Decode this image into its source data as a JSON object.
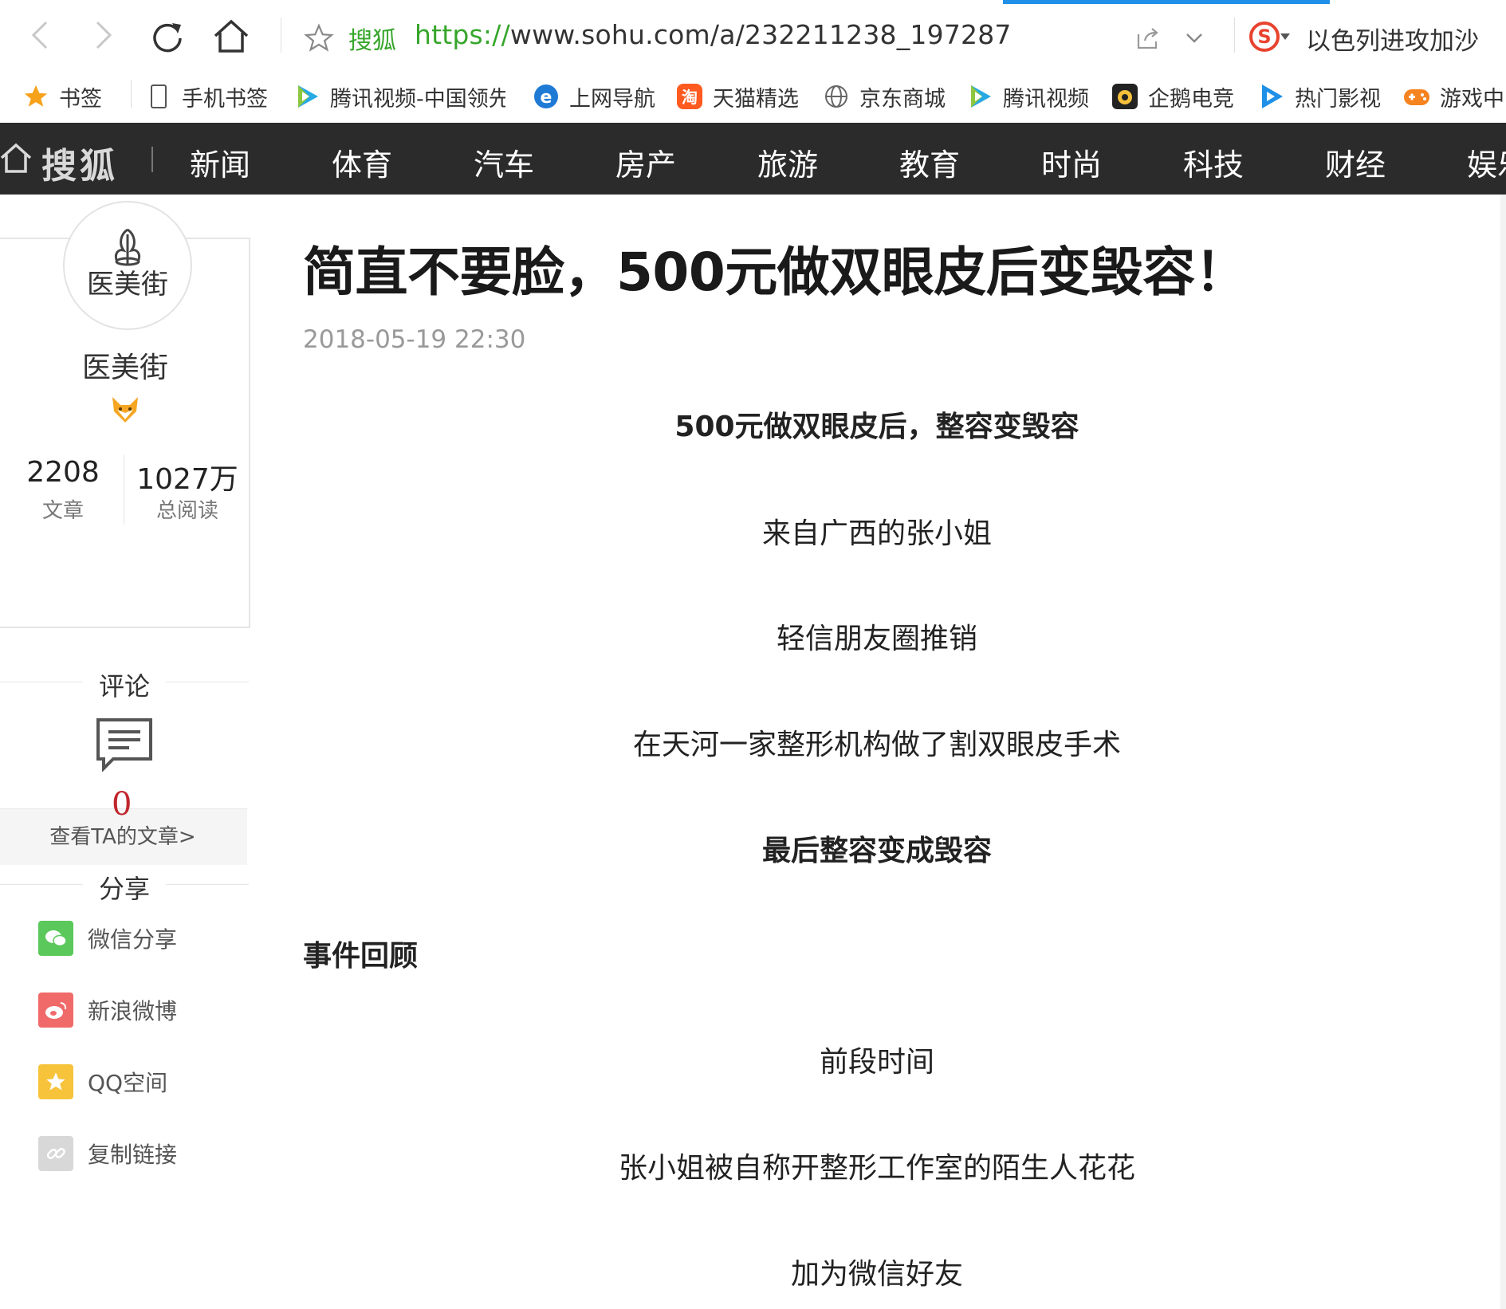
{
  "browser": {
    "site_name": "搜狐",
    "url_protocol": "https://",
    "url_rest": "www.sohu.com/a/232211238_197287",
    "search_hint": "以色列进攻加沙"
  },
  "bookmarks": [
    {
      "label": "书签",
      "icon": "star-icon"
    },
    {
      "label": "手机书签",
      "icon": "phone-icon"
    },
    {
      "label": "腾讯视频-中国领先",
      "icon": "tencent-video-icon"
    },
    {
      "label": "上网导航",
      "icon": "ie-icon"
    },
    {
      "label": "天猫精选",
      "icon": "taobao-icon"
    },
    {
      "label": "京东商城",
      "icon": "globe-icon"
    },
    {
      "label": "腾讯视频",
      "icon": "tencent-video-icon"
    },
    {
      "label": "企鹅电竞",
      "icon": "penguin-esports-icon"
    },
    {
      "label": "热门影视",
      "icon": "play-icon"
    },
    {
      "label": "游戏中",
      "icon": "gamepad-icon"
    }
  ],
  "nav": {
    "logo": "搜狐",
    "items": [
      "新闻",
      "体育",
      "汽车",
      "房产",
      "旅游",
      "教育",
      "时尚",
      "科技",
      "财经",
      "娱乐"
    ]
  },
  "author": {
    "avatar_text": "医美街",
    "name": "医美街",
    "articles_count": "2208",
    "articles_label": "文章",
    "reads_count": "1027万",
    "reads_label": "总阅读",
    "view_link": "查看TA的文章>"
  },
  "comments": {
    "title": "评论",
    "count": "0"
  },
  "share": {
    "title": "分享",
    "items": [
      {
        "label": "微信分享",
        "color": "#5ac85a"
      },
      {
        "label": "新浪微博",
        "color": "#f06a6a"
      },
      {
        "label": "QQ空间",
        "color": "#f7c33b"
      },
      {
        "label": "复制链接",
        "color": "#d8d8d8"
      }
    ]
  },
  "article": {
    "title": "简直不要脸，500元做双眼皮后变毁容！",
    "date": "2018-05-19 22:30",
    "paragraphs": [
      {
        "text": "500元做双眼皮后，整容变毁容",
        "bold": true
      },
      {
        "text": "来自广西的张小姐",
        "bold": false
      },
      {
        "text": "轻信朋友圈推销",
        "bold": false
      },
      {
        "text": "在天河一家整形机构做了割双眼皮手术",
        "bold": false
      },
      {
        "text": "最后整容变成毁容",
        "bold": true
      },
      {
        "text": "事件回顾",
        "bold": true
      },
      {
        "text": "前段时间",
        "bold": false
      },
      {
        "text": "张小姐被自称开整形工作室的陌生人花花",
        "bold": false
      },
      {
        "text": "加为微信好友",
        "bold": false
      }
    ]
  },
  "colors": {
    "nav_bg": "#2b2b2b",
    "url_green": "#36a62b",
    "comment_red": "#c0262d",
    "load_blue": "#1e90e8"
  }
}
